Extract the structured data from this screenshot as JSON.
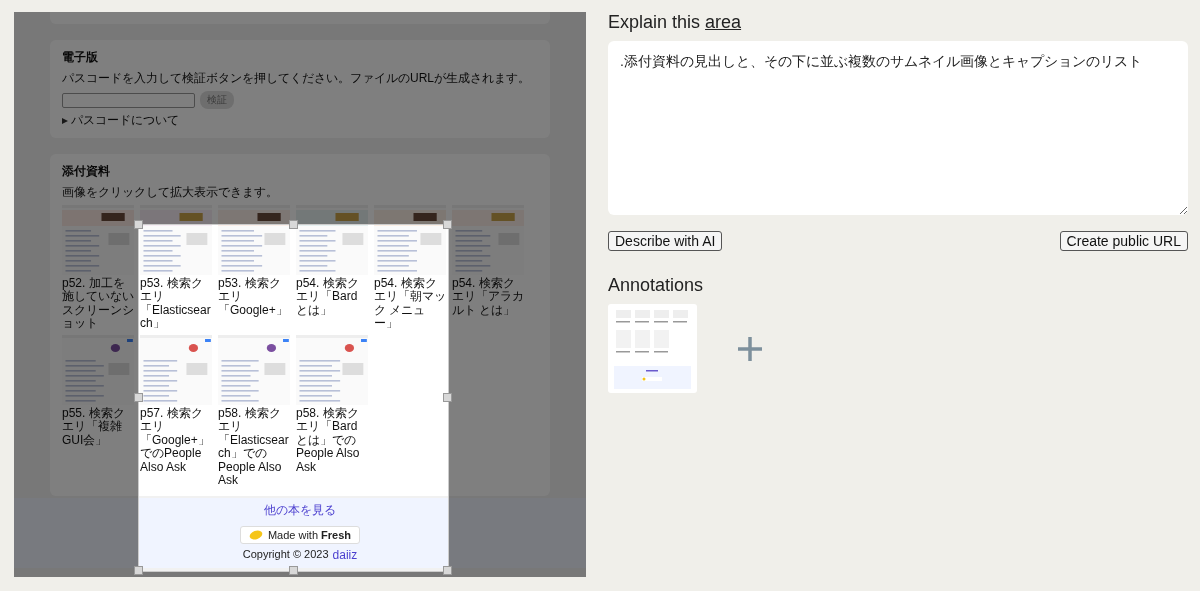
{
  "ebook": {
    "title": "電子版",
    "description": "パスコードを入力して検証ボタンを押してください。ファイルのURLが生成されます。",
    "button": "検証",
    "details": "パスコードについて"
  },
  "attachments": {
    "title": "添付資料",
    "description": "画像をクリックして拡大表示できます。",
    "items": [
      {
        "caption": "p52. 加工を施していないスクリーンショット"
      },
      {
        "caption": "p53. 検索クエリ「Elasticsearch」"
      },
      {
        "caption": "p53. 検索クエリ「Google+」"
      },
      {
        "caption": "p54. 検索クエリ「Bard とは」"
      },
      {
        "caption": "p54. 検索クエリ「朝マック メニュー」"
      },
      {
        "caption": "p54. 検索クエリ「アラカルト とは」"
      },
      {
        "caption": "p55. 検索クエリ「複雑GUI会」"
      },
      {
        "caption": "p57. 検索クエリ「Google+」でのPeople Also Ask"
      },
      {
        "caption": "p58. 検索クエリ「Elasticsearch」でのPeople Also Ask"
      },
      {
        "caption": "p58. 検索クエリ「Bard とは」でのPeople Also Ask"
      }
    ]
  },
  "footer": {
    "link": "他の本を見る",
    "badge": "Made with **Fresh**",
    "copyright": "Copyright © 2023",
    "author": "daiiz"
  },
  "explain": {
    "title": "Explain this",
    "link": "area",
    "value": ".添付資料の見出しと、その下に並ぶ複数のサムネイル画像とキャプションのリスト"
  },
  "buttons": [
    "Describe with AI",
    "Create public URL"
  ],
  "annotations": {
    "title": "Annotations"
  }
}
